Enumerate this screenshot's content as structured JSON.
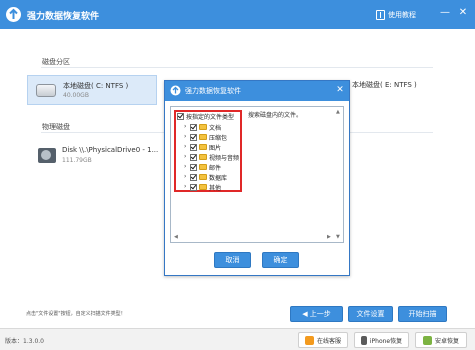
{
  "app": {
    "title": "强力数据恢复软件",
    "help_label": "使用教程",
    "minimize_label": "—",
    "close_label": "✕"
  },
  "sections": {
    "partitions_label": "磁盘分区",
    "physical_label": "物理磁盘"
  },
  "partitions": [
    {
      "name": "本地磁盘( C: NTFS )",
      "size": "40.00GB"
    },
    {
      "name": "本地磁盘( E: NTFS )"
    }
  ],
  "physical_disk": {
    "name": "Disk \\\\.\\PhysicalDrive0 - 1...",
    "size": "111.79GB"
  },
  "dialog": {
    "title": "强力数据恢复软件",
    "close_label": "✕",
    "root_label": "按指定的文件类型",
    "root_desc": "搜索磁盘内的文件。",
    "items": [
      {
        "label": "文档"
      },
      {
        "label": "压缩包"
      },
      {
        "label": "图片"
      },
      {
        "label": "视频与音频"
      },
      {
        "label": "邮件"
      },
      {
        "label": "数据库"
      },
      {
        "label": "其他"
      }
    ],
    "cancel_label": "取消",
    "ok_label": "确定"
  },
  "bottom": {
    "hint": "点击\"文件设置\"按钮，自定义扫描文件类型！",
    "prev_label": "上一步",
    "file_settings_label": "文件设置",
    "start_scan_label": "开始扫描"
  },
  "status": {
    "version": "版本：1.3.0.0",
    "online_label": "在线客服",
    "iphone_label": "iPhone恢复",
    "android_label": "安卓恢复"
  },
  "colors": {
    "accent": "#3d8fdd",
    "highlight_border": "#e02828",
    "selection_bg": "#dceaf9"
  }
}
